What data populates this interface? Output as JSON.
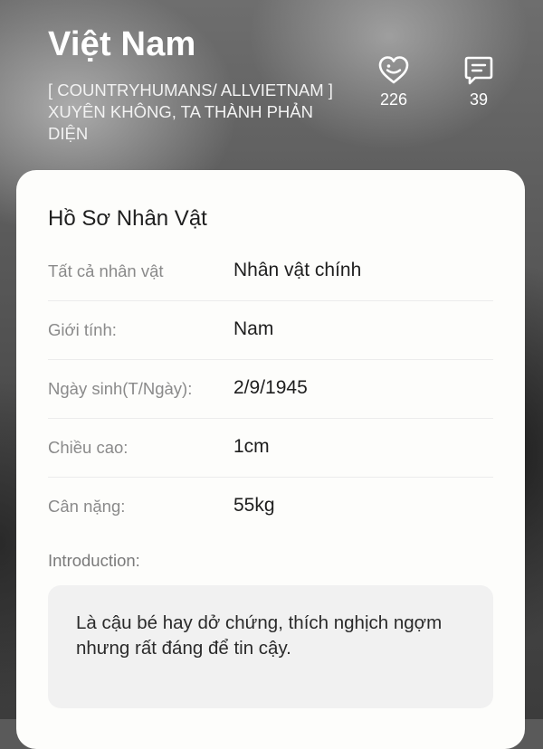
{
  "header": {
    "title": "Việt Nam",
    "subtitle": "[ COUNTRYHUMANS/ ALLVIETNAM ] XUYÊN KHÔNG, TA THÀNH PHẢN DIỆN",
    "likes": {
      "count": "226",
      "icon": "heart-smile-icon"
    },
    "comments": {
      "count": "39",
      "icon": "comment-icon"
    }
  },
  "profile": {
    "title": "Hồ Sơ Nhân Vật",
    "fields": [
      {
        "label": "Tất cả nhân vật",
        "value": "Nhân vật chính"
      },
      {
        "label": "Giới tính:",
        "value": "Nam"
      },
      {
        "label": "Ngày sinh(T/Ngày):",
        "value": "2/9/1945"
      },
      {
        "label": "Chiều cao:",
        "value": "1cm"
      },
      {
        "label": "Cân nặng:",
        "value": "55kg"
      }
    ],
    "intro_label": "Introduction:",
    "intro_text": "Là cậu bé hay dở chứng, thích nghịch ngợm nhưng rất đáng để tin cậy."
  },
  "colors": {
    "card_bg": "#fdfdfb",
    "intro_bg": "#f1f1f1",
    "label": "#8a8a8a",
    "value": "#1e1e1e"
  }
}
